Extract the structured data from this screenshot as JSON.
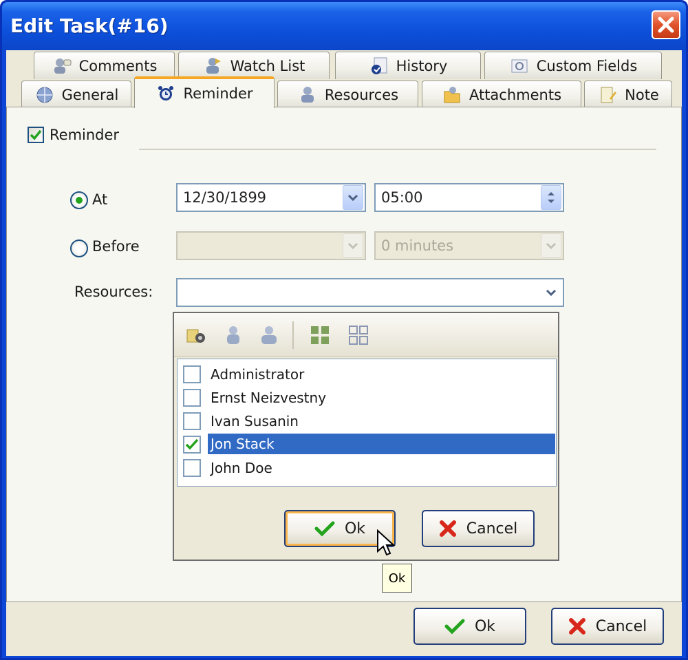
{
  "window": {
    "title": "Edit Task(#16)"
  },
  "tabs_top": [
    {
      "label": "Comments",
      "icon": "comments-icon"
    },
    {
      "label": "Watch List",
      "icon": "watch-list-icon"
    },
    {
      "label": "History",
      "icon": "history-icon"
    },
    {
      "label": "Custom Fields",
      "icon": "custom-fields-icon"
    }
  ],
  "tabs_bottom": [
    {
      "label": "General",
      "icon": "globe-icon"
    },
    {
      "label": "Reminder",
      "icon": "alarm-clock-icon",
      "active": true
    },
    {
      "label": "Resources",
      "icon": "resources-icon"
    },
    {
      "label": "Attachments",
      "icon": "attachments-icon"
    },
    {
      "label": "Note",
      "icon": "note-icon"
    }
  ],
  "reminder": {
    "checkbox_label": "Reminder",
    "checked": true,
    "at_label": "At",
    "at_selected": true,
    "at_date": "12/30/1899",
    "at_time": "05:00",
    "before_label": "Before",
    "before_date": "",
    "before_offset": "0 minutes",
    "resources_label": "Resources:",
    "resources_value": ""
  },
  "popup": {
    "toolbar_icons": [
      "add-resource-icon",
      "user-icon",
      "user-group-icon",
      "select-all-icon",
      "deselect-all-icon"
    ],
    "items": [
      {
        "label": "Administrator",
        "checked": false,
        "selected": false
      },
      {
        "label": "Ernst Neizvestny",
        "checked": false,
        "selected": false
      },
      {
        "label": "Ivan Susanin",
        "checked": false,
        "selected": false
      },
      {
        "label": "Jon Stack",
        "checked": true,
        "selected": true
      },
      {
        "label": "John Doe",
        "checked": false,
        "selected": false
      }
    ],
    "ok_label": "Ok",
    "cancel_label": "Cancel",
    "tooltip": "Ok"
  },
  "footer": {
    "ok_label": "Ok",
    "cancel_label": "Cancel"
  },
  "colors": {
    "titlebar": "#0b46d6",
    "selection": "#316ac5",
    "active_tab_accent": "#f5a623",
    "ok_check": "#23a31e",
    "cancel_x": "#d8281b"
  }
}
